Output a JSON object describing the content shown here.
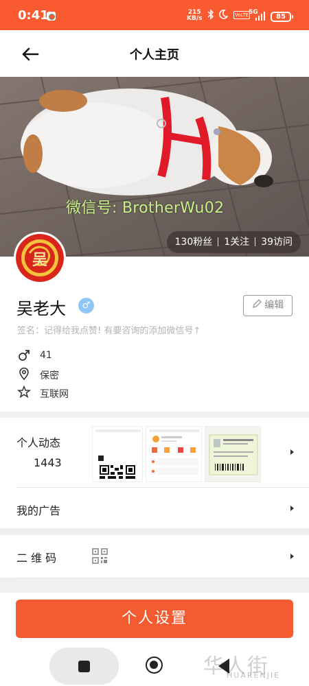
{
  "status_bar": {
    "time": "0:41",
    "net_speed_value": "215",
    "net_speed_unit": "KB/s",
    "volte": "VoLTE",
    "network": "5G",
    "battery": "85"
  },
  "header": {
    "title": "个人主页"
  },
  "cover": {
    "watermark": "微信号: BrotherWu02",
    "stats": {
      "fans": "130粉丝",
      "following": "1关注",
      "visits": "39访问"
    }
  },
  "profile": {
    "avatar_text": "吴",
    "name": "吴老大",
    "gender_symbol": "♂",
    "edit_label": "编辑",
    "signature": "签名：记得给我点赞! 有要咨询的添加微信号↑",
    "age": "41",
    "location": "保密",
    "industry": "互联网"
  },
  "menu": {
    "moments_label": "个人动态",
    "moments_count": "1443",
    "ads_label": "我的广告",
    "qrcode_label": "二  维  码"
  },
  "settings_label": "个人设置",
  "watermark": {
    "logo": "华人街",
    "sub": "HUARENJIE"
  },
  "colors": {
    "accent": "#fa5a30",
    "button": "#f55b30",
    "gender_badge": "#8fc6f4",
    "signature": "#b4b4b4"
  }
}
